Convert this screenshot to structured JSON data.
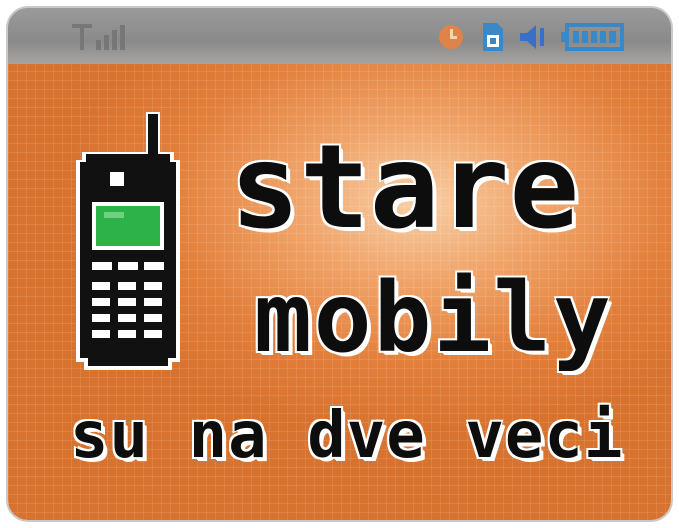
{
  "status_bar": {
    "icons": [
      "signal-icon",
      "clock-icon",
      "sim-card-icon",
      "speaker-icon",
      "battery-icon"
    ],
    "colors": {
      "bar": "#8f8f8f",
      "signal": "#6e6e6e",
      "clock": "#e0834a",
      "sim": "#3a88c8",
      "speaker": "#3a6fc8",
      "battery": "#3a88c8"
    }
  },
  "illustration": {
    "icon": "mobile-phone-icon",
    "colors": {
      "body": "#111111",
      "outline": "#ffffff",
      "display": "#2bb34a"
    }
  },
  "text": {
    "line1": "stare",
    "line2": "mobily",
    "line3": "su na dve veci"
  },
  "colors": {
    "background": "#e27f3b",
    "highlight": "#f7cfa6",
    "text": "#0d0d0d",
    "text_outline": "#ffffff"
  }
}
